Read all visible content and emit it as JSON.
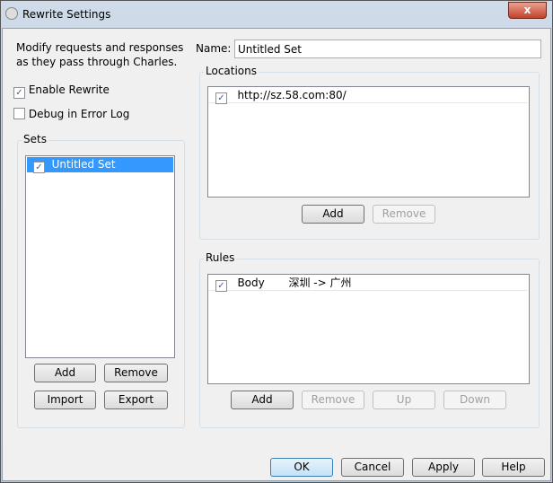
{
  "window": {
    "title": "Rewrite Settings",
    "close_label": "x"
  },
  "intro": "Modify requests and responses as they pass through Charles.",
  "enable_rewrite": {
    "label": "Enable Rewrite",
    "checked": true
  },
  "debug": {
    "label": "Debug in Error Log",
    "checked": false
  },
  "sets": {
    "label": "Sets",
    "items": [
      {
        "name": "Untitled Set",
        "checked": true
      }
    ],
    "add": "Add",
    "remove": "Remove",
    "import": "Import",
    "export": "Export"
  },
  "name": {
    "label": "Name:",
    "value": "Untitled Set"
  },
  "locations": {
    "label": "Locations",
    "items": [
      {
        "url": "http://sz.58.com:80/",
        "checked": true
      }
    ],
    "add": "Add",
    "remove": "Remove"
  },
  "rules": {
    "label": "Rules",
    "items": [
      {
        "type": "Body",
        "desc": "深圳 -> 广州",
        "checked": true
      }
    ],
    "add": "Add",
    "remove": "Remove",
    "up": "Up",
    "down": "Down"
  },
  "footer": {
    "ok": "OK",
    "cancel": "Cancel",
    "apply": "Apply",
    "help": "Help"
  }
}
